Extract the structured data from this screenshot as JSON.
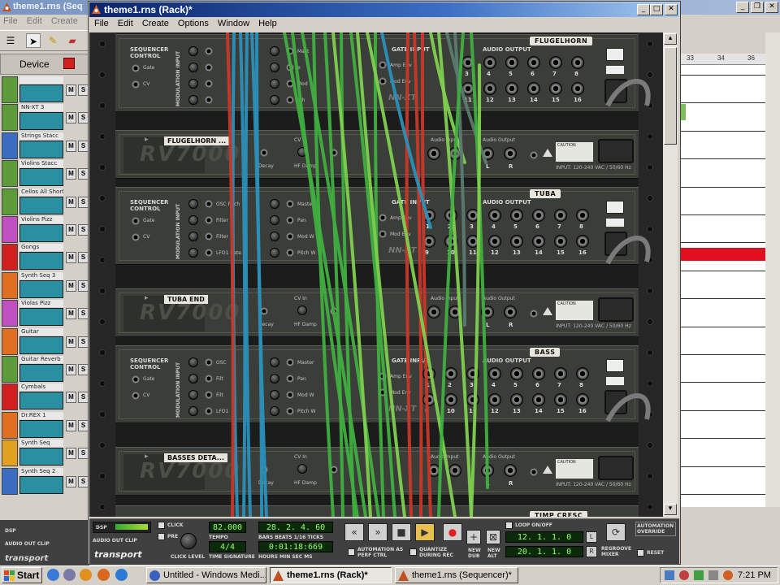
{
  "seq_window": {
    "title": "theme1.rns (Seq",
    "menu": [
      "File",
      "Edit",
      "Create"
    ],
    "device_label": "Device",
    "tracks": [
      {
        "name": "",
        "color": "#5c9a3a"
      },
      {
        "name": "NN-XT 3",
        "color": "#5c9a3a"
      },
      {
        "name": "Strings Stacc",
        "color": "#3a6cc0"
      },
      {
        "name": "Violins Stacc",
        "color": "#5c9a3a"
      },
      {
        "name": "Cellos All Short",
        "color": "#5c9a3a"
      },
      {
        "name": "Violins Pizz",
        "color": "#c050c0"
      },
      {
        "name": "Gongs",
        "color": "#d02020"
      },
      {
        "name": "Synth Seq 3",
        "color": "#e07020"
      },
      {
        "name": "Violas Pizz",
        "color": "#c050c0"
      },
      {
        "name": "Guitar",
        "color": "#e07020"
      },
      {
        "name": "Guitar Reverb",
        "color": "#5c9a3a"
      },
      {
        "name": "Cymbals",
        "color": "#d02020"
      },
      {
        "name": "Dr.REX 1",
        "color": "#e07020"
      },
      {
        "name": "Synth Seq",
        "color": "#e0a020"
      },
      {
        "name": "Synth Seq 2",
        "color": "#3a6cc0"
      }
    ],
    "mute_label": "M",
    "solo_label": "S",
    "ruler": [
      "33",
      "34",
      "36"
    ]
  },
  "rack_window": {
    "title": "theme1.rns (Rack)*",
    "menu": [
      "File",
      "Edit",
      "Create",
      "Options",
      "Window",
      "Help"
    ],
    "sampler_labels": {
      "seq_control": "SEQUENCER CONTROL",
      "gate": "Gate",
      "cv": "CV",
      "mod_input": "MODULATION INPUT",
      "mod_rows_top": [
        "",
        "",
        "",
        ""
      ],
      "mod_rows_full": [
        "OSC Pitch",
        "Filter",
        "Filter",
        "LFO1 Rate"
      ],
      "mod_rows_partial": [
        "OSC",
        "Filt",
        "Filt",
        "LFO1"
      ],
      "right_rows_top": [
        "Mast",
        "e",
        "Mod",
        "tch"
      ],
      "right_rows_full": [
        "Master",
        "Pan",
        "Mod W",
        "Pitch W"
      ],
      "gate_input": "GATE INPUT",
      "gate_rows": [
        "Amp Env",
        "Mod Env"
      ],
      "audio_output": "AUDIO OUTPUT",
      "logo": "NN-XT",
      "jacks_top": [
        "3",
        "4",
        "5",
        "6",
        "7",
        "8"
      ],
      "jacks_bottom": [
        "11",
        "12",
        "13",
        "14",
        "15",
        "16"
      ],
      "jacks_top_alt": [
        "1",
        "2",
        "3",
        "4",
        "5",
        "6",
        "7",
        "8"
      ],
      "jacks_bottom_alt": [
        "9",
        "10",
        "11",
        "12",
        "13",
        "14",
        "15",
        "16"
      ]
    },
    "samplers": [
      {
        "name": "FLUGELHORN"
      },
      {
        "name": "TUBA"
      },
      {
        "name": "BASS"
      }
    ],
    "reverbs": [
      {
        "name": "FLUGELHORN ..."
      },
      {
        "name": "TUBA END"
      },
      {
        "name": "BASSES DETA..."
      }
    ],
    "reverb_labels": {
      "logo": "RV7000",
      "cv_in": "CV In",
      "decay": "Decay",
      "hf_damp": "HF Damp",
      "audio_input": "Audio Input",
      "audio_output": "Audio Output",
      "l": "L",
      "r": "R",
      "caution": "CAUTION",
      "input_power": "INPUT: 120-240 VAC / 50/60 Hz"
    },
    "bottom_unit": "TIMP CRESC"
  },
  "transport": {
    "dsp": "DSP",
    "audio_out_clip": "AUDIO OUT CLIP",
    "brand": "transport",
    "click": "CLICK",
    "pre": "PRE",
    "click_level": "CLICK LEVEL",
    "tempo_value": "82.000",
    "tempo_label": "TEMPO",
    "sig_value": "4/4",
    "sig_label": "TIME SIGNATURE",
    "position_value": "28. 2. 4. 60",
    "position_label": "BARS BEATS 1/16 TICKS",
    "time_value": "0:01:18:669",
    "time_label": "HOURS   MIN   SEC   MS",
    "automation": "AUTOMATION AS PERF CTRL",
    "quantize": "QUANTIZE DURING REC",
    "new_dub": "NEW DUB",
    "new_alt": "NEW ALT",
    "loop": "LOOP ON/OFF",
    "loop_left": "12. 1. 1. 0",
    "loop_right": "20. 1. 1. 0",
    "l": "L",
    "r": "R",
    "regroove": "REGROOVE MIXER",
    "override": "AUTOMATION OVERRIDE",
    "reset": "RESET"
  },
  "taskbar": {
    "start": "Start",
    "tasks": [
      "Untitled - Windows Medi...",
      "theme1.rns (Rack)*",
      "theme1.rns (Sequencer)*"
    ],
    "clock": "7:21 PM"
  },
  "colors": {
    "cable_red": "#c8382a",
    "cable_teal": "#2b8fb8",
    "cable_green": "#3fae3f",
    "cable_lightgreen": "#7fcf4f",
    "cable_darkgray": "#5a7a70",
    "lcd": "#9cff6c"
  }
}
